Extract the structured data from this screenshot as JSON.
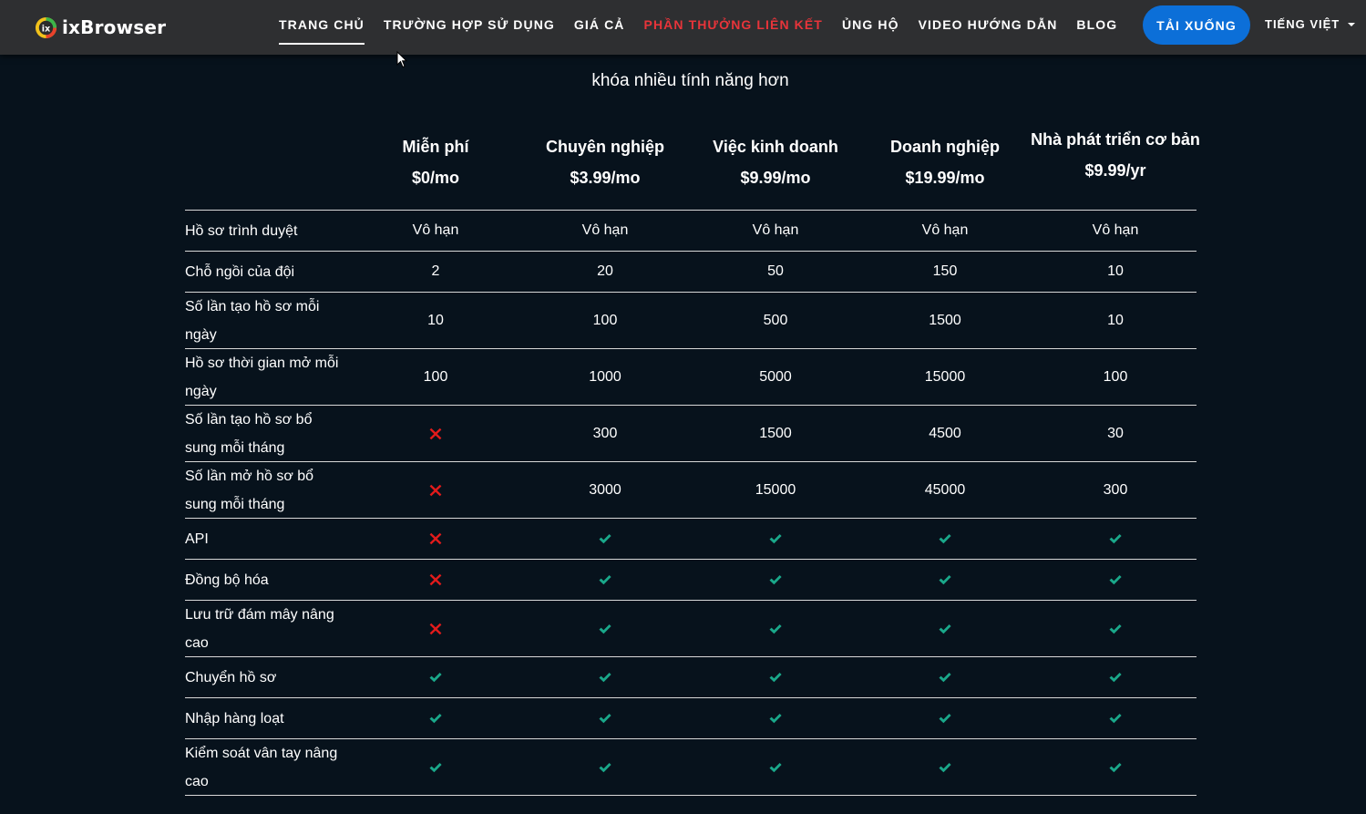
{
  "nav": {
    "logo_text": "ixBrowser",
    "items": [
      {
        "label": "TRANG CHỦ"
      },
      {
        "label": "TRƯỜNG HỢP SỬ DỤNG"
      },
      {
        "label": "GIÁ CẢ"
      },
      {
        "label": "PHẦN THƯỞNG LIÊN KẾT"
      },
      {
        "label": "ỦNG HỘ"
      },
      {
        "label": "VIDEO HƯỚNG DẪN"
      },
      {
        "label": "BLOG"
      }
    ],
    "active_item": "TRANG CHỦ",
    "download_label": "TẢI XUỐNG",
    "language_label": "TIẾNG VIỆT",
    "colors": {
      "nav_bg": "#2e2f31",
      "promo": "#e8343a",
      "button": "#0c6fd8"
    }
  },
  "subtitle": "khóa nhiều tính năng hơn",
  "plans": [
    {
      "name": "Miễn phí",
      "price": "$0/mo"
    },
    {
      "name": "Chuyên nghiệp",
      "price": "$3.99/mo"
    },
    {
      "name": "Việc kinh doanh",
      "price": "$9.99/mo"
    },
    {
      "name": "Doanh nghiệp",
      "price": "$19.99/mo"
    },
    {
      "name": "Nhà phát triển cơ bản",
      "price": "$9.99/yr"
    }
  ],
  "rows": [
    {
      "feature": "Hồ sơ trình duyệt",
      "values": [
        "Vô hạn",
        "Vô hạn",
        "Vô hạn",
        "Vô hạn",
        "Vô hạn"
      ]
    },
    {
      "feature": "Chỗ ngồi của đội",
      "values": [
        "2",
        "20",
        "50",
        "150",
        "10"
      ]
    },
    {
      "feature": "Số lần tạo hồ sơ mỗi ngày",
      "values": [
        "10",
        "100",
        "500",
        "1500",
        "10"
      ]
    },
    {
      "feature": "Hồ sơ thời gian mở mỗi ngày",
      "values": [
        "100",
        "1000",
        "5000",
        "15000",
        "100"
      ]
    },
    {
      "feature": "Số lần tạo hồ sơ bổ sung mỗi tháng",
      "values": [
        "cross",
        "300",
        "1500",
        "4500",
        "30"
      ]
    },
    {
      "feature": "Số lần mở hồ sơ bổ sung mỗi tháng",
      "values": [
        "cross",
        "3000",
        "15000",
        "45000",
        "300"
      ]
    },
    {
      "feature": "API",
      "values": [
        "cross",
        "check",
        "check",
        "check",
        "check"
      ]
    },
    {
      "feature": "Đồng bộ hóa",
      "values": [
        "cross",
        "check",
        "check",
        "check",
        "check"
      ]
    },
    {
      "feature": "Lưu trữ đám mây nâng cao",
      "values": [
        "cross",
        "check",
        "check",
        "check",
        "check"
      ]
    },
    {
      "feature": "Chuyển hồ sơ",
      "values": [
        "check",
        "check",
        "check",
        "check",
        "check"
      ]
    },
    {
      "feature": "Nhập hàng loạt",
      "values": [
        "check",
        "check",
        "check",
        "check",
        "check"
      ]
    },
    {
      "feature": "Kiểm soát vân tay nâng cao",
      "values": [
        "check",
        "check",
        "check",
        "check",
        "check"
      ]
    }
  ],
  "icon_colors": {
    "check": "#1aa88a",
    "cross": "#e21b1b"
  }
}
